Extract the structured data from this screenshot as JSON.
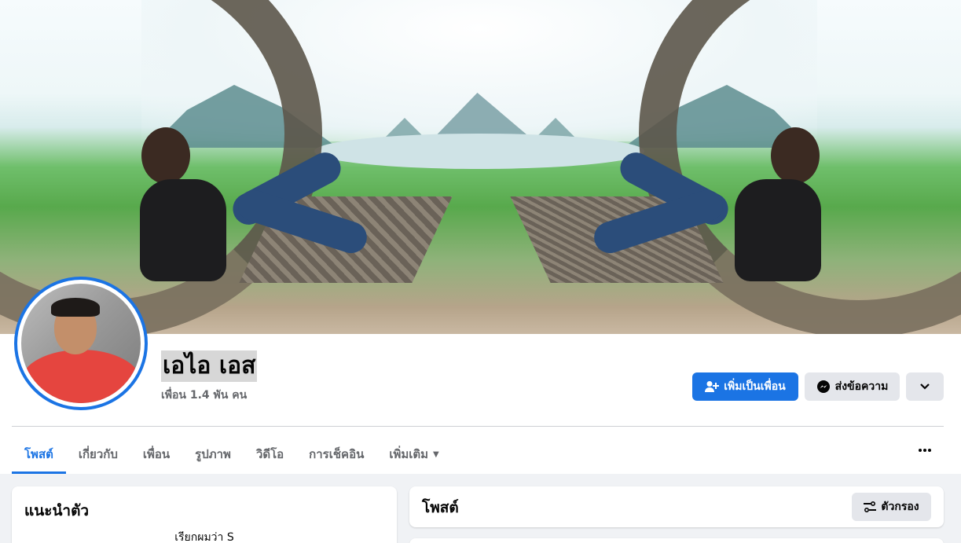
{
  "profile": {
    "name": "เอไอ เอส",
    "friends_count": "เพื่อน 1.4 พัน คน"
  },
  "actions": {
    "add_friend": "เพิ่มเป็นเพื่อน",
    "message": "ส่งข้อความ"
  },
  "tabs": [
    {
      "label": "โพสต์",
      "active": true
    },
    {
      "label": "เกี่ยวกับ"
    },
    {
      "label": "เพื่อน"
    },
    {
      "label": "รูปภาพ"
    },
    {
      "label": "วิดีโอ"
    },
    {
      "label": "การเช็คอิน"
    },
    {
      "label": "เพิ่มเติม"
    }
  ],
  "intro": {
    "title": "แนะนำตัว",
    "bio": "เรียกผมว่า S"
  },
  "posts": {
    "title": "โพสต์",
    "filter_label": "ตัวกรอง"
  },
  "colors": {
    "accent": "#1b74e4",
    "secondary_button": "#e4e6eb",
    "page_bg": "#f0f2f5"
  },
  "icons": [
    "add-friend-icon",
    "messenger-icon",
    "chevron-down-icon",
    "more-dots-icon",
    "filter-icon",
    "caret-down-icon"
  ]
}
